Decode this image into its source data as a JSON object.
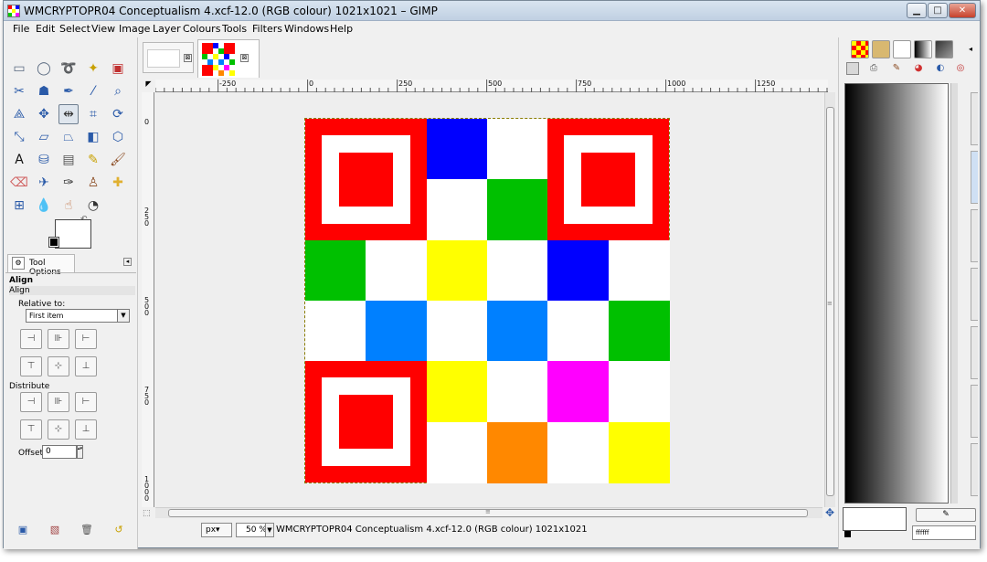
{
  "window": {
    "title": "WMCRYPTOPR04 Conceptualism 4.xcf-12.0 (RGB colour) 1021x1021 – GIMP",
    "minimize_glyph": "▁",
    "maximize_glyph": "□",
    "close_glyph": "✕"
  },
  "menubar": {
    "items": [
      "File",
      "Edit",
      "Select",
      "View",
      "Image",
      "Layer",
      "Colours",
      "Tools",
      "Filters",
      "Windows",
      "Help"
    ]
  },
  "toolbox": {
    "tools": [
      {
        "icon": "rect-select-icon",
        "glyph": "▭",
        "color": "#5a6a80"
      },
      {
        "icon": "ellipse-select-icon",
        "glyph": "◯",
        "color": "#5a6a80"
      },
      {
        "icon": "free-select-icon",
        "glyph": "➰",
        "color": "#5a6a80"
      },
      {
        "icon": "fuzzy-select-icon",
        "glyph": "✦",
        "color": "#c8a000"
      },
      {
        "icon": "select-by-color-icon",
        "glyph": "▣",
        "color": "#c03030"
      },
      {
        "icon": "scissors-select-icon",
        "glyph": "✂",
        "color": "#2a5aa8"
      },
      {
        "icon": "foreground-select-icon",
        "glyph": "☗",
        "color": "#2a5aa8"
      },
      {
        "icon": "paths-icon",
        "glyph": "✒",
        "color": "#2a5aa8"
      },
      {
        "icon": "color-picker-icon",
        "glyph": "⁄",
        "color": "#2a5aa8"
      },
      {
        "icon": "zoom-icon",
        "glyph": "⌕",
        "color": "#2a5aa8"
      },
      {
        "icon": "measure-icon",
        "glyph": "⟁",
        "color": "#2a5aa8"
      },
      {
        "icon": "move-icon",
        "glyph": "✥",
        "color": "#2a5aa8"
      },
      {
        "icon": "align-icon",
        "glyph": "⇹",
        "color": "#333333"
      },
      {
        "icon": "crop-icon",
        "glyph": "⌗",
        "color": "#2a5aa8"
      },
      {
        "icon": "rotate-icon",
        "glyph": "⟳",
        "color": "#2a5aa8"
      },
      {
        "icon": "scale-icon",
        "glyph": "⤡",
        "color": "#2a5aa8"
      },
      {
        "icon": "shear-icon",
        "glyph": "▱",
        "color": "#2a5aa8"
      },
      {
        "icon": "perspective-icon",
        "glyph": "⏢",
        "color": "#2a5aa8"
      },
      {
        "icon": "flip-icon",
        "glyph": "◧",
        "color": "#2a5aa8"
      },
      {
        "icon": "cage-transform-icon",
        "glyph": "⬡",
        "color": "#2a5aa8"
      },
      {
        "icon": "text-icon",
        "glyph": "A",
        "color": "#111111"
      },
      {
        "icon": "bucket-fill-icon",
        "glyph": "⛁",
        "color": "#2a5aa8"
      },
      {
        "icon": "blend-icon",
        "glyph": "▤",
        "color": "#555555"
      },
      {
        "icon": "pencil-icon",
        "glyph": "✎",
        "color": "#c8a000"
      },
      {
        "icon": "paintbrush-icon",
        "glyph": "🖌",
        "color": "#8a4a20"
      },
      {
        "icon": "eraser-icon",
        "glyph": "⌫",
        "color": "#d06060"
      },
      {
        "icon": "airbrush-icon",
        "glyph": "✈",
        "color": "#2a5aa8"
      },
      {
        "icon": "ink-icon",
        "glyph": "✑",
        "color": "#333333"
      },
      {
        "icon": "clone-icon",
        "glyph": "♙",
        "color": "#8a4a20"
      },
      {
        "icon": "heal-icon",
        "glyph": "✚",
        "color": "#e0b030"
      },
      {
        "icon": "perspective-clone-icon",
        "glyph": "⊞",
        "color": "#2a5aa8"
      },
      {
        "icon": "blur-icon",
        "glyph": "💧",
        "color": "#2a5aa8"
      },
      {
        "icon": "smudge-icon",
        "glyph": "☝",
        "color": "#c07040"
      },
      {
        "icon": "dodge-burn-icon",
        "glyph": "◔",
        "color": "#333333"
      }
    ],
    "swap_glyph": "↶"
  },
  "tool_options": {
    "tab_label": "Tool Options",
    "tab_icon_glyph": "⚙",
    "tab_menu_glyph": "◂",
    "heading": "Align",
    "sub_heading": "Align",
    "relative_to_label": "Relative to:",
    "relative_to_value": "First item",
    "combo_arrow_glyph": "▼",
    "align_buttons": [
      {
        "icon": "align-left-edge-icon",
        "glyph": "⊣"
      },
      {
        "icon": "align-center-horizontal-icon",
        "glyph": "⊪"
      },
      {
        "icon": "align-right-edge-icon",
        "glyph": "⊢"
      },
      {
        "icon": "align-top-edge-icon",
        "glyph": "⊤"
      },
      {
        "icon": "align-middle-vertical-icon",
        "glyph": "⊹"
      },
      {
        "icon": "align-bottom-edge-icon",
        "glyph": "⊥"
      }
    ],
    "distribute_label": "Distribute",
    "distribute_buttons": [
      {
        "icon": "distribute-left-icon",
        "glyph": "⊣"
      },
      {
        "icon": "distribute-center-horizontal-icon",
        "glyph": "⊪"
      },
      {
        "icon": "distribute-right-icon",
        "glyph": "⊢"
      },
      {
        "icon": "distribute-top-icon",
        "glyph": "⊤"
      },
      {
        "icon": "distribute-middle-vertical-icon",
        "glyph": "⊹"
      },
      {
        "icon": "distribute-bottom-icon",
        "glyph": "⊥"
      }
    ],
    "offset_label": "Offset:",
    "offset_value": "0",
    "spin_glyph": "▴▾"
  },
  "toolbox_bottom": [
    {
      "icon": "save-options-icon",
      "glyph": "▣",
      "color": "#2a5aa8"
    },
    {
      "icon": "restore-options-icon",
      "glyph": "▧",
      "color": "#a04040"
    },
    {
      "icon": "delete-options-icon",
      "glyph": "🗑",
      "color": "#555555"
    },
    {
      "icon": "reset-options-icon",
      "glyph": "↺",
      "color": "#c8a000"
    }
  ],
  "image_tabs": {
    "close_glyph": "⊠"
  },
  "rulers": {
    "corner_glyph": "◤",
    "h_labels": [
      "-250",
      "0",
      "250",
      "500",
      "750",
      "1000",
      "1250"
    ],
    "v_labels": [
      "0",
      "2\n5\n0",
      "5\n0\n0",
      "7\n5\n0",
      "1\n0\n0\n0"
    ]
  },
  "canvas": {
    "cells": [
      {
        "r": 0,
        "c": 2,
        "color": "#0000ff"
      },
      {
        "r": 0,
        "c": 3,
        "color": "#ffffff"
      },
      {
        "r": 1,
        "c": 2,
        "color": "#ffffff"
      },
      {
        "r": 1,
        "c": 3,
        "color": "#00c000"
      },
      {
        "r": 2,
        "c": 0,
        "color": "#00c000"
      },
      {
        "r": 2,
        "c": 1,
        "color": "#ffffff"
      },
      {
        "r": 2,
        "c": 2,
        "color": "#ffff00"
      },
      {
        "r": 2,
        "c": 3,
        "color": "#ffffff"
      },
      {
        "r": 2,
        "c": 4,
        "color": "#0000ff"
      },
      {
        "r": 2,
        "c": 5,
        "color": "#ffffff"
      },
      {
        "r": 3,
        "c": 0,
        "color": "#ffffff"
      },
      {
        "r": 3,
        "c": 1,
        "color": "#0080ff"
      },
      {
        "r": 3,
        "c": 2,
        "color": "#ffffff"
      },
      {
        "r": 3,
        "c": 3,
        "color": "#0080ff"
      },
      {
        "r": 3,
        "c": 4,
        "color": "#ffffff"
      },
      {
        "r": 3,
        "c": 5,
        "color": "#00c000"
      },
      {
        "r": 4,
        "c": 2,
        "color": "#ffff00"
      },
      {
        "r": 4,
        "c": 3,
        "color": "#ffffff"
      },
      {
        "r": 4,
        "c": 4,
        "color": "#ff00ff"
      },
      {
        "r": 4,
        "c": 5,
        "color": "#ffffff"
      },
      {
        "r": 5,
        "c": 2,
        "color": "#ffffff"
      },
      {
        "r": 5,
        "c": 3,
        "color": "#ff8800"
      },
      {
        "r": 5,
        "c": 4,
        "color": "#ffffff"
      },
      {
        "r": 5,
        "c": 5,
        "color": "#ffff00"
      }
    ],
    "finders": [
      {
        "r": 0,
        "c": 0
      },
      {
        "r": 0,
        "c": 4
      },
      {
        "r": 4,
        "c": 0
      }
    ]
  },
  "scroll": {
    "grip_glyph": "≡",
    "nav_glyph": "✥",
    "qmask_glyph": "⬚"
  },
  "statusbar": {
    "unit": "px▾",
    "zoom": "50 %",
    "zoom_arrow_glyph": "▼",
    "text": "WMCRYPTOPR04 Conceptualism 4.xcf-12.0 (RGB colour) 1021x1021"
  },
  "dock": {
    "menu_glyph": "◂",
    "hex_value": "ffffff",
    "edit_glyph": "✎"
  }
}
